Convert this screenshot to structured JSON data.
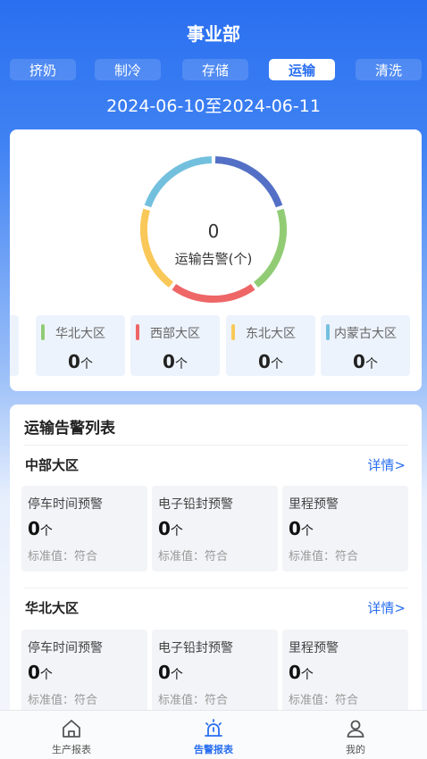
{
  "header": {
    "title": "事业部"
  },
  "tabs": [
    {
      "label": "挤奶",
      "active": false
    },
    {
      "label": "制冷",
      "active": false
    },
    {
      "label": "存储",
      "active": false
    },
    {
      "label": "运输",
      "active": true
    },
    {
      "label": "清洗",
      "active": false
    }
  ],
  "date_range": "2024-06-10至2024-06-11",
  "summary": {
    "count": "0",
    "label": "运输告警(个)",
    "ring_colors": [
      "#5470c6",
      "#91cc75",
      "#ee6666",
      "#fac858",
      "#73c0de"
    ]
  },
  "regions": [
    {
      "name": "华北大区",
      "value": "0",
      "unit": "个",
      "color": "#91cc75"
    },
    {
      "name": "西部大区",
      "value": "0",
      "unit": "个",
      "color": "#ee6666"
    },
    {
      "name": "东北大区",
      "value": "0",
      "unit": "个",
      "color": "#fac858"
    },
    {
      "name": "内蒙古大区",
      "value": "0",
      "unit": "个",
      "color": "#73c0de"
    }
  ],
  "alert_list": {
    "title": "运输告警列表",
    "groups": [
      {
        "name": "中部大区",
        "detail": "详情>",
        "metrics": [
          {
            "name": "停车时间预警",
            "value": "0",
            "unit": "个",
            "standard": "标准值：符合"
          },
          {
            "name": "电子铅封预警",
            "value": "0",
            "unit": "个",
            "standard": "标准值：符合"
          },
          {
            "name": "里程预警",
            "value": "0",
            "unit": "个",
            "standard": "标准值：符合"
          }
        ]
      },
      {
        "name": "华北大区",
        "detail": "详情>",
        "metrics": [
          {
            "name": "停车时间预警",
            "value": "0",
            "unit": "个",
            "standard": "标准值：符合"
          },
          {
            "name": "电子铅封预警",
            "value": "0",
            "unit": "个",
            "standard": "标准值：符合"
          },
          {
            "name": "里程预警",
            "value": "0",
            "unit": "个",
            "standard": "标准值：符合"
          }
        ]
      }
    ]
  },
  "nav": [
    {
      "label": "生产报表",
      "icon": "home-icon",
      "active": false
    },
    {
      "label": "告警报表",
      "icon": "alarm-icon",
      "active": true
    },
    {
      "label": "我的",
      "icon": "user-icon",
      "active": false
    }
  ],
  "colors": {
    "primary": "#2a6ff0"
  }
}
